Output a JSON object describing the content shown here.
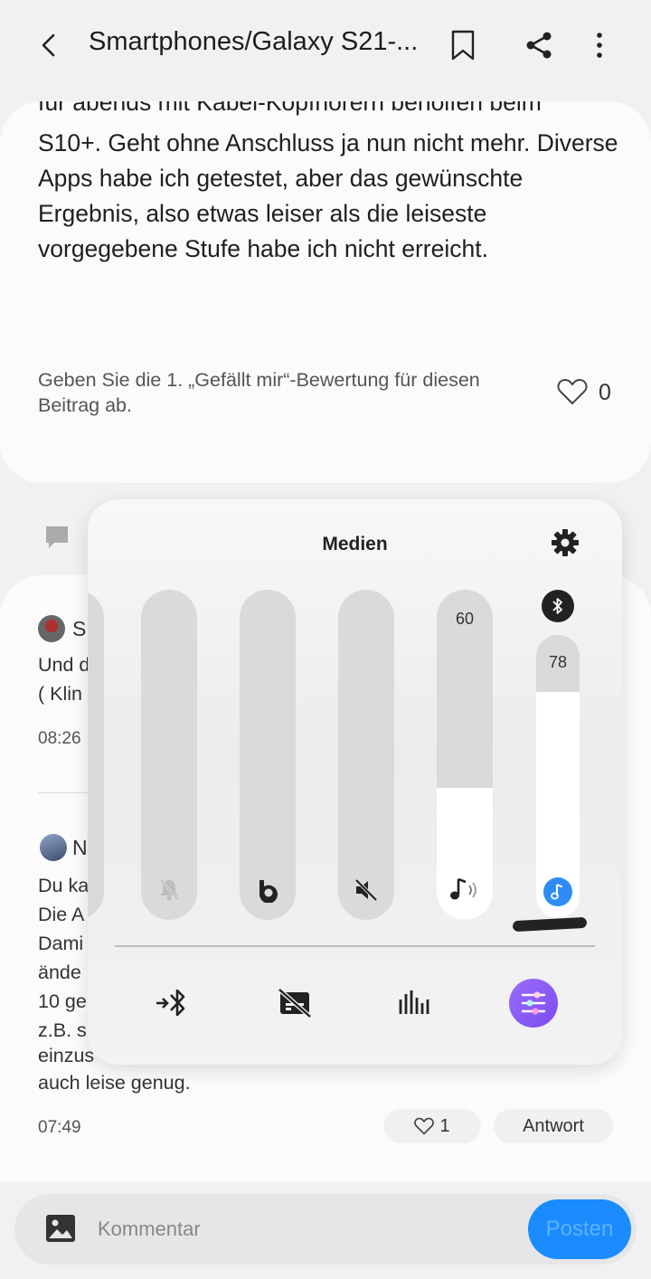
{
  "header": {
    "title": "Smartphones/Galaxy S21-...",
    "back_icon": "arrow-left-icon",
    "bookmark_icon": "bookmark-icon",
    "share_icon": "share-icon",
    "more_icon": "more-vert-icon"
  },
  "post": {
    "text_cut": "für abends mit Kabel-Kopfhörern beholfen beim",
    "text": "S10+. Geht ohne Anschluss ja nun nicht mehr. Diverse Apps habe ich getestet, aber das gewünschte Ergebnis, also etwas leiser als die leiseste vorgegebene Stufe habe ich nicht erreicht.",
    "like_prompt": "Geben Sie die 1. „Gefällt mir“-Bewertung für diesen Beitrag ab.",
    "like_count": "0"
  },
  "comments": [
    {
      "author_initial": "S",
      "lines": [
        "Und d",
        "( Klin"
      ],
      "time": "08:26"
    },
    {
      "author_initial": "N",
      "lines": [
        "Du ka",
        "Die A",
        "Dami",
        "ände",
        "10 ge",
        "z.B. s",
        "einzus",
        "auch leise genug."
      ],
      "time": "07:49",
      "likes": "1",
      "reply_label": "Antwort"
    }
  ],
  "comment_bar": {
    "placeholder": "Kommentar",
    "post_label": "Posten"
  },
  "volume_panel": {
    "title": "Medien",
    "sliders": [
      {
        "name": "notification",
        "icon": "bell-muted-icon",
        "level": 0
      },
      {
        "name": "bixby",
        "icon": "bixby-icon",
        "level": 0
      },
      {
        "name": "system",
        "icon": "speaker-muted-icon",
        "level": 0
      },
      {
        "name": "media",
        "icon": "music-volume-icon",
        "level": 60,
        "value_label": "60",
        "fill_fraction": 0.4
      },
      {
        "name": "bluetooth-media",
        "icon": "music-note-icon",
        "level": 78,
        "value_label": "78",
        "fill_fraction": 0.8
      }
    ],
    "actions": [
      "bluetooth-connect-icon",
      "no-caption-icon",
      "equalizer-icon",
      "sound-settings-icon"
    ],
    "accent_color": "#7b4cf0"
  }
}
